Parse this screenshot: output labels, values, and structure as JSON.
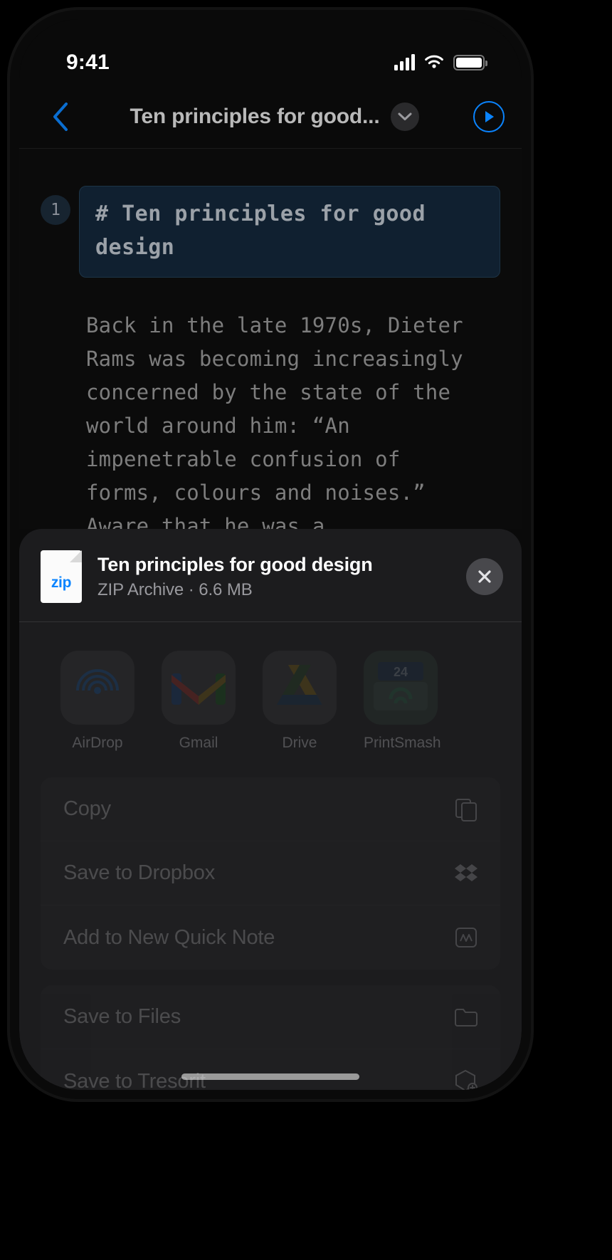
{
  "status_bar": {
    "time": "9:41",
    "cellular_icon": "signal-bars-icon",
    "wifi_icon": "wifi-icon",
    "battery_icon": "battery-icon"
  },
  "nav_bar": {
    "back_icon": "back-chevron-icon",
    "title": "Ten principles for good...",
    "disclosure_icon": "chevron-down-icon",
    "play_icon": "play-circle-icon",
    "accent_color": "#0a84ff"
  },
  "document": {
    "line_number": "1",
    "heading": "# Ten principles for good design",
    "heading_bg": "#102030",
    "body": "Back in the late 1970s, Dieter Rams was becoming increasingly concerned by the state of the world around him: “An impenetrable confusion of forms, colours and noises.” Aware that he was a"
  },
  "share_sheet": {
    "file": {
      "icon_label": "zip",
      "title": "Ten principles for good design",
      "subtitle": "ZIP Archive · 6.6 MB"
    },
    "close_icon": "close-icon",
    "apps": [
      {
        "label": "AirDrop",
        "icon": "airdrop-icon"
      },
      {
        "label": "Gmail",
        "icon": "gmail-icon"
      },
      {
        "label": "Drive",
        "icon": "google-drive-icon"
      },
      {
        "label": "PrintSmash",
        "icon": "printsmash-icon"
      }
    ],
    "action_groups": [
      {
        "rows": [
          {
            "label": "Copy",
            "icon": "copy-icon"
          },
          {
            "label": "Save to Dropbox",
            "icon": "dropbox-icon"
          },
          {
            "label": "Add to New Quick Note",
            "icon": "quick-note-icon"
          }
        ]
      },
      {
        "rows": [
          {
            "label": "Save to Files",
            "icon": "folder-icon"
          },
          {
            "label": "Save to Tresorit",
            "icon": "tresorit-icon"
          }
        ]
      }
    ]
  }
}
